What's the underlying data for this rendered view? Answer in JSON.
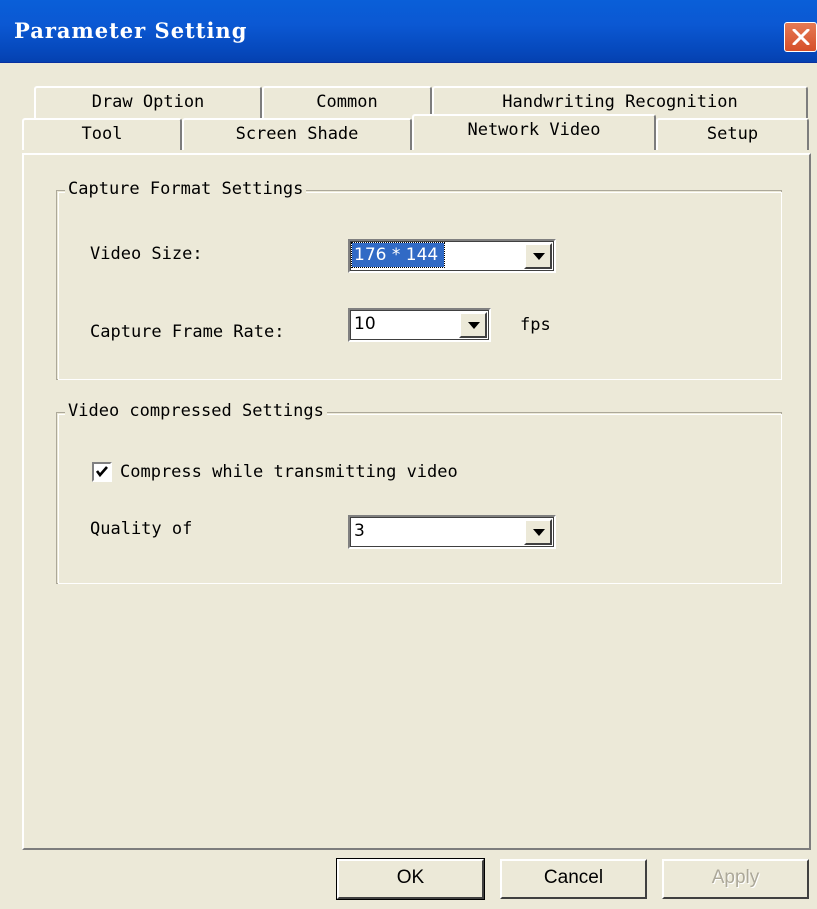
{
  "window": {
    "title": "Parameter Setting"
  },
  "tabs_back_row": [
    "Draw Option",
    "Common",
    "Handwriting Recognition"
  ],
  "tabs_front_row": [
    "Tool",
    "Screen Shade",
    "Network Video",
    "Setup"
  ],
  "active_tab": "Network Video",
  "capture": {
    "legend": "Capture Format Settings",
    "video_size_label": "Video Size:",
    "video_size_value": "176 * 144",
    "frame_rate_label": "Capture Frame Rate:",
    "frame_rate_value": "10",
    "fps_label": "fps"
  },
  "compression": {
    "legend": "Video compressed Settings",
    "compress_label": "Compress while transmitting video",
    "compress_checked": true,
    "quality_label": "Quality of",
    "quality_value": "3"
  },
  "buttons": {
    "ok": "OK",
    "cancel": "Cancel",
    "apply": "Apply"
  }
}
